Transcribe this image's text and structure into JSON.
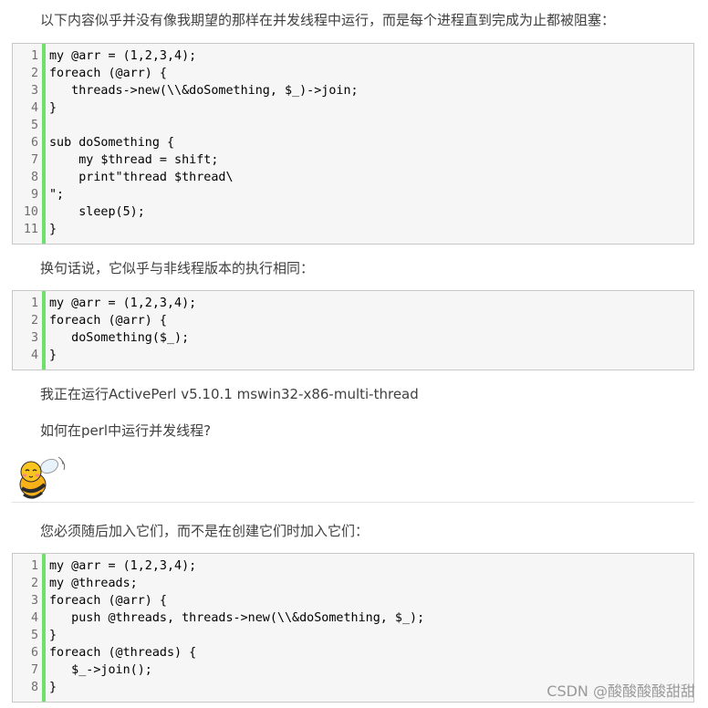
{
  "paragraphs": {
    "p1": "以下内容似乎并没有像我期望的那样在并发线程中运行，而是每个进程直到完成为止都被阻塞：",
    "p2": "换句话说，它似乎与非线程版本的执行相同：",
    "p3": "我正在运行ActivePerl v5.10.1 mswin32-x86-multi-thread",
    "p4": "如何在perl中运行并发线程?",
    "p5": "您必须随后加入它们，而不是在创建它们时加入它们："
  },
  "code_blocks": [
    {
      "lines": [
        {
          "n": "1",
          "t": "my @arr = (1,2,3,4);"
        },
        {
          "n": "2",
          "t": "foreach (@arr) {"
        },
        {
          "n": "3",
          "t": "   threads->new(\\\\&doSomething, $_)->join;"
        },
        {
          "n": "4",
          "t": "}"
        },
        {
          "n": "5",
          "t": ""
        },
        {
          "n": "6",
          "t": "sub doSomething {"
        },
        {
          "n": "7",
          "t": "    my $thread = shift;"
        },
        {
          "n": "8",
          "t": "    print\"thread $thread\\"
        },
        {
          "n": "9",
          "t": "\";"
        },
        {
          "n": "10",
          "t": "    sleep(5);"
        },
        {
          "n": "11",
          "t": "}"
        }
      ]
    },
    {
      "lines": [
        {
          "n": "1",
          "t": "my @arr = (1,2,3,4);"
        },
        {
          "n": "2",
          "t": "foreach (@arr) {"
        },
        {
          "n": "3",
          "t": "   doSomething($_);"
        },
        {
          "n": "4",
          "t": "}"
        }
      ]
    },
    {
      "lines": [
        {
          "n": "1",
          "t": "my @arr = (1,2,3,4);"
        },
        {
          "n": "2",
          "t": "my @threads;"
        },
        {
          "n": "3",
          "t": "foreach (@arr) {"
        },
        {
          "n": "4",
          "t": "   push @threads, threads->new(\\\\&doSomething, $_);"
        },
        {
          "n": "5",
          "t": "}"
        },
        {
          "n": "6",
          "t": "foreach (@threads) {"
        },
        {
          "n": "7",
          "t": "   $_->join();"
        },
        {
          "n": "8",
          "t": "}"
        }
      ]
    }
  ],
  "watermark": "CSDN @酸酸酸酸甜甜",
  "icons": {
    "avatar": "bee-avatar-icon"
  },
  "colors": {
    "gutter_accent": "#6ce26c",
    "code_bg": "#f6f6f6"
  }
}
